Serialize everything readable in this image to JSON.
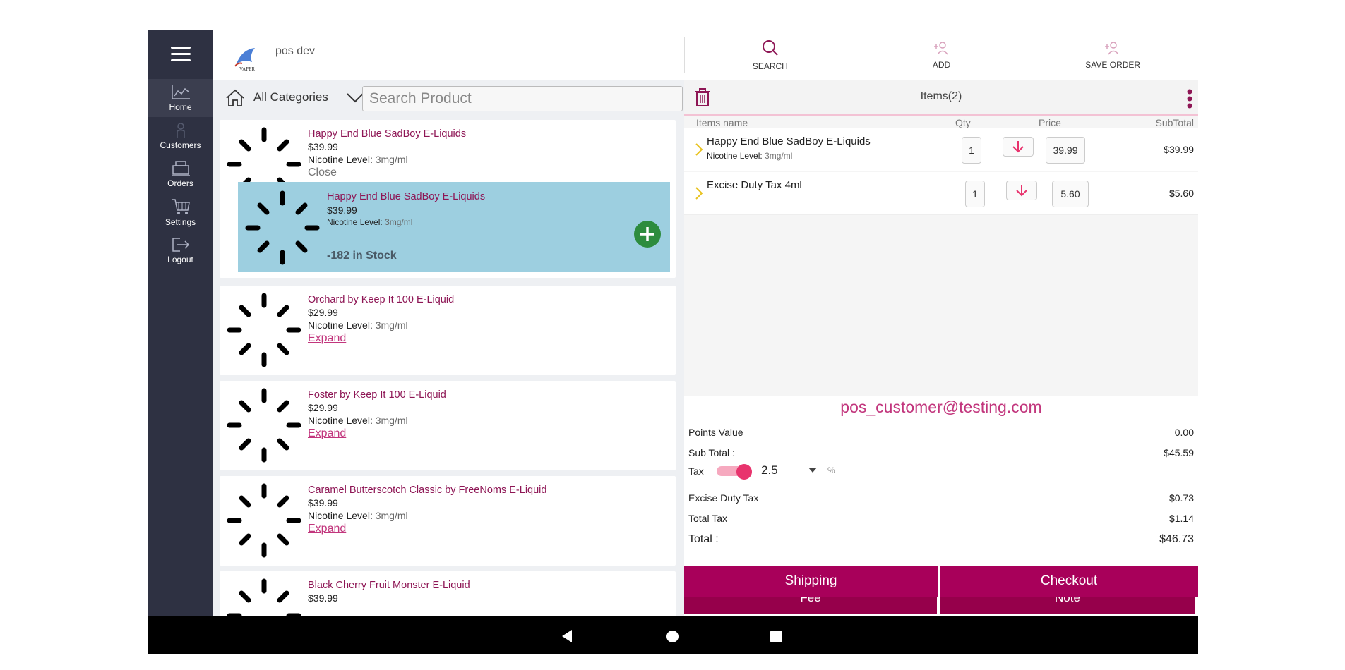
{
  "sidebar": {
    "menu_icon": "hamburger-icon",
    "items": [
      {
        "label": "Home",
        "icon": "chart-icon"
      },
      {
        "label": "Customers",
        "icon": "person-icon"
      },
      {
        "label": "Orders",
        "icon": "register-icon"
      },
      {
        "label": "Settings",
        "icon": "cart-icon"
      },
      {
        "label": "Logout",
        "icon": "logout-icon"
      }
    ]
  },
  "header": {
    "store_name": "pos dev",
    "logo_text": "VAPER",
    "actions": [
      {
        "label": "SEARCH",
        "icon": "search-icon"
      },
      {
        "label": "ADD",
        "icon": "add-user-icon"
      },
      {
        "label": "SAVE ORDER",
        "icon": "save-user-icon"
      }
    ]
  },
  "catalog": {
    "category": "All Categories",
    "search_placeholder": "Search Product",
    "products": [
      {
        "name": "Happy End Blue SadBoy E-Liquids",
        "price": "$39.99",
        "nicotine_label": "Nicotine Level:",
        "nicotine_value": "3mg/ml",
        "action": "Close",
        "expanded": {
          "name": "Happy End Blue SadBoy E-Liquids",
          "price": "$39.99",
          "nicotine_label": "Nicotine Level:",
          "nicotine_value": "3mg/ml",
          "stock": "-182 in Stock"
        }
      },
      {
        "name": "Orchard by Keep It 100 E-Liquid",
        "price": "$29.99",
        "nicotine_label": "Nicotine Level:",
        "nicotine_value": "3mg/ml",
        "action": "Expand"
      },
      {
        "name": "Foster by Keep It 100 E-Liquid",
        "price": "$29.99",
        "nicotine_label": "Nicotine Level:",
        "nicotine_value": "3mg/ml",
        "action": "Expand"
      },
      {
        "name": "Caramel Butterscotch Classic by FreeNoms E-Liquid",
        "price": "$39.99",
        "nicotine_label": "Nicotine Level:",
        "nicotine_value": "3mg/ml",
        "action": "Expand"
      },
      {
        "name": "Black Cherry Fruit Monster E-Liquid",
        "price": "$39.99"
      }
    ]
  },
  "cart": {
    "items_count": "Items(2)",
    "columns": {
      "name": "Items name",
      "qty": "Qty",
      "price": "Price",
      "subtotal": "SubTotal"
    },
    "lines": [
      {
        "name": "Happy End Blue SadBoy E-Liquids",
        "nicotine_label": "Nicotine Level:",
        "nicotine_value": "3mg/ml",
        "qty": "1",
        "price": "39.99",
        "subtotal": "$39.99"
      },
      {
        "name": "Excise Duty Tax 4ml",
        "qty": "1",
        "price": "5.60",
        "subtotal": "$5.60"
      }
    ],
    "customer_email": "pos_customer@testing.com",
    "points_label": "Points Value",
    "points_value": "0.00",
    "subtotal_label": "Sub Total :",
    "subtotal_value": "$45.59",
    "tax_label": "Tax",
    "tax_rate": "2.5",
    "tax_unit": "%",
    "tax_enabled": true,
    "excise_label": "Excise Duty Tax",
    "excise_value": "$0.73",
    "total_tax_label": "Total Tax",
    "total_tax_value": "$1.14",
    "total_label": "Total :",
    "total_value": "$46.73",
    "buttons": {
      "fee": "Fee",
      "note": "Note",
      "shipping": "Shipping",
      "checkout": "Checkout"
    }
  },
  "colors": {
    "brand": "#96004b",
    "accent": "#c2367d",
    "sidebar": "#2e3142",
    "highlight": "#9dcfe0"
  }
}
